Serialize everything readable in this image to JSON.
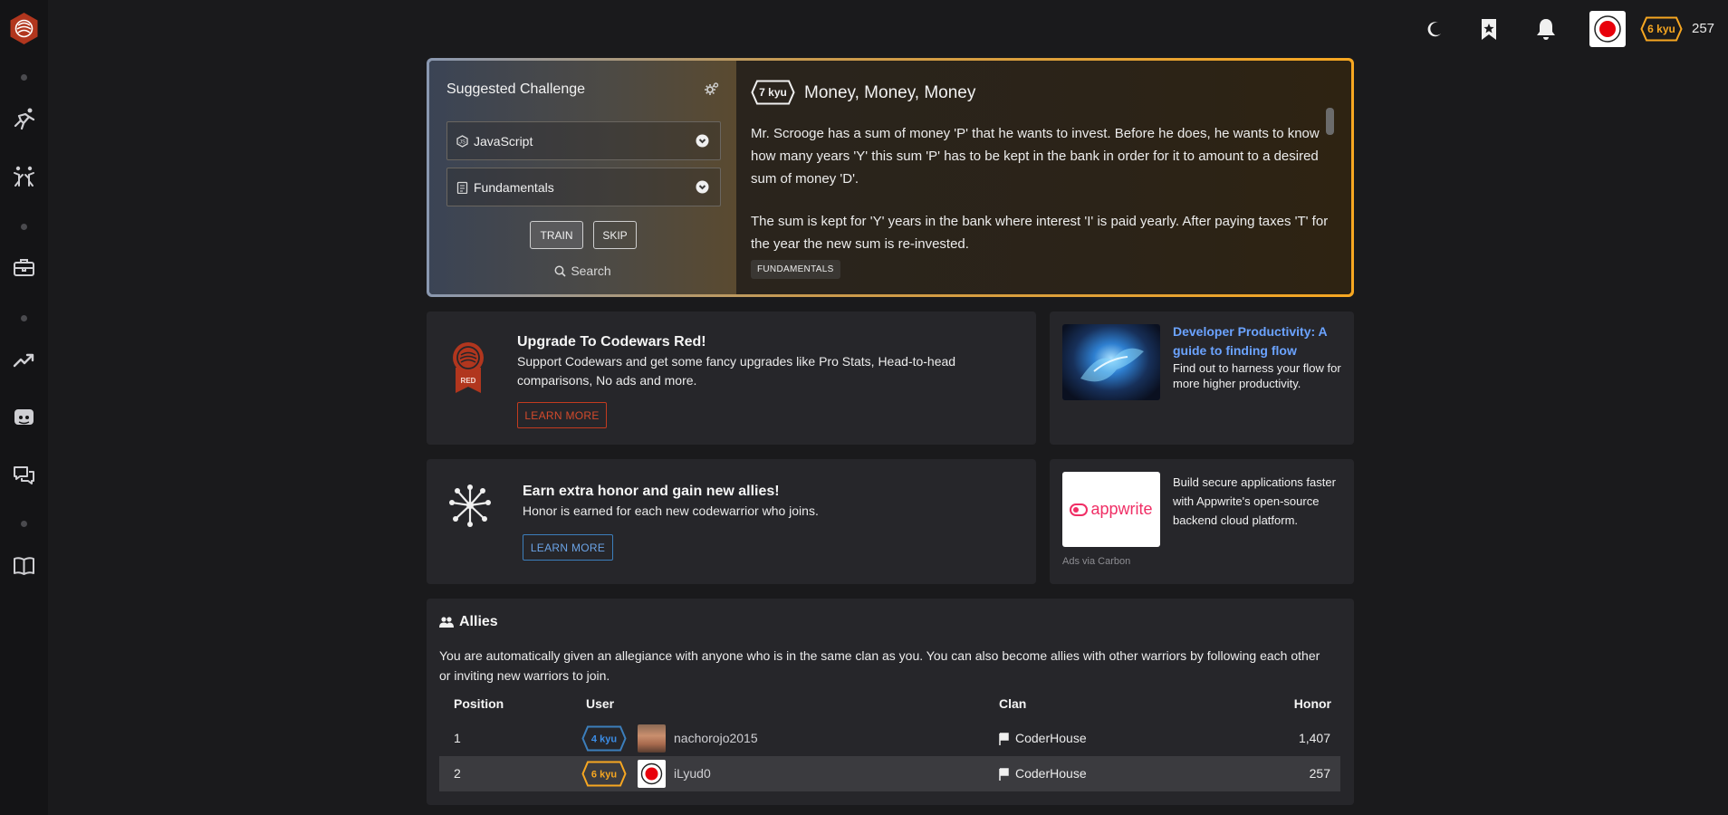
{
  "header": {
    "honor": "257",
    "rank": "6 kyu",
    "icons": [
      "moon-icon",
      "bookmark-icon",
      "bell-icon",
      "avatar"
    ]
  },
  "sidebar": {
    "items": [
      "logo",
      "training-icon",
      "kumite-icon",
      "jobs-icon",
      "leaderboard-icon",
      "discord-icon",
      "chat-icon",
      "docs-icon"
    ]
  },
  "challenge": {
    "heading": "Suggested Challenge",
    "language": "JavaScript",
    "focus": "Fundamentals",
    "train_label": "TRAIN",
    "skip_label": "SKIP",
    "search_label": "Search",
    "kata": {
      "kyu": "7 kyu",
      "title": "Money, Money, Money",
      "paragraph1": "Mr. Scrooge has a sum of money 'P' that he wants to invest. Before he does, he wants to know how many years 'Y' this sum 'P' has to be kept in the bank in order for it to amount to a desired sum of money 'D'.",
      "paragraph2": "The sum is kept for 'Y' years in the bank where interest 'I' is paid yearly. After paying taxes 'T' for the year the new sum is re-invested.",
      "tag": "FUNDAMENTALS"
    }
  },
  "upgrade": {
    "title": "Upgrade To Codewars Red!",
    "text": "Support Codewars and get some fancy upgrades like Pro Stats, Head-to-head comparisons, No ads and more.",
    "button": "LEARN MORE",
    "badge_label": "RED"
  },
  "honor_promo": {
    "title": "Earn extra honor and gain new allies!",
    "text": "Honor is earned for each new codewarrior who joins.",
    "button": "LEARN MORE"
  },
  "ad1": {
    "title": "Developer Productivity: A guide to finding flow",
    "text": "Find out to harness your flow for more higher productivity."
  },
  "ad2": {
    "logo_text": "appwrite",
    "text": "Build secure applications faster with Appwrite's open-source backend cloud platform.",
    "via": "Ads via Carbon"
  },
  "allies": {
    "title": "Allies",
    "description": "You are automatically given an allegiance with anyone who is in the same clan as you. You can also become allies with other warriors by following each other or inviting new warriors to join.",
    "columns": [
      "Position",
      "User",
      "Clan",
      "Honor"
    ],
    "rows": [
      {
        "position": "1",
        "rank": "4 kyu",
        "user": "nachorojo2015",
        "clan": "CoderHouse",
        "honor": "1,407"
      },
      {
        "position": "2",
        "rank": "6 kyu",
        "user": "iLyud0",
        "clan": "CoderHouse",
        "honor": "257"
      }
    ]
  },
  "colors": {
    "accent_red": "#b1361e",
    "gold": "#f7a721",
    "blue": "#3c7ebb",
    "link_blue": "#6ba3ff"
  }
}
